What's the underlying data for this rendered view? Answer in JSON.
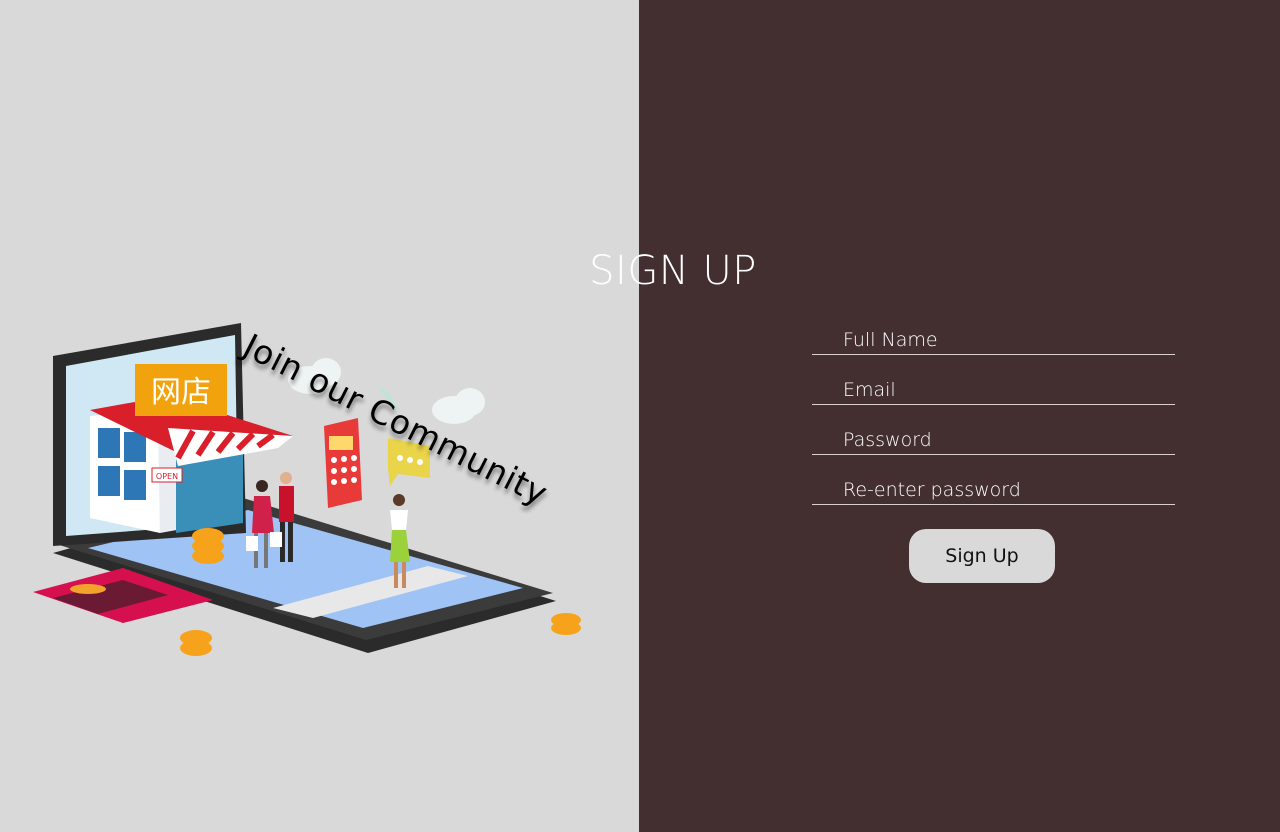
{
  "left": {
    "tagline": "Join our Community",
    "illustration": {
      "shop_sign": "网店",
      "open_sign": "OPEN"
    }
  },
  "form": {
    "title": "SIGN UP",
    "fields": [
      {
        "placeholder": "Full Name"
      },
      {
        "placeholder": "Email"
      },
      {
        "placeholder": "Password"
      },
      {
        "placeholder": "Re-enter password"
      }
    ],
    "submit_label": "Sign Up"
  },
  "colors": {
    "left_bg": "#d9d9d9",
    "right_bg": "#432e30",
    "button_bg": "#d9d9d9"
  }
}
